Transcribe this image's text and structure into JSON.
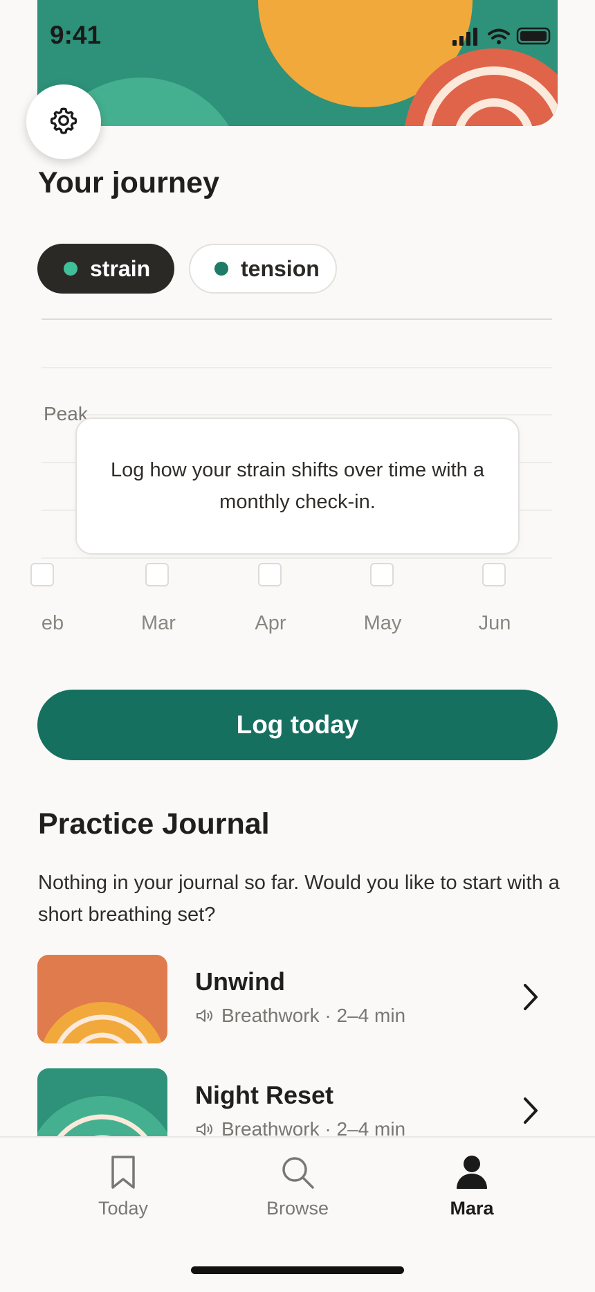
{
  "status_bar": {
    "time": "9:41"
  },
  "header": {
    "settings_icon": "gear-icon"
  },
  "journey": {
    "title": "Your journey",
    "chips": [
      {
        "label": "strain",
        "active": true,
        "dot_color": "#3fbf9a"
      },
      {
        "label": "tension",
        "active": false,
        "dot_color": "#1f7a66"
      }
    ],
    "chart": {
      "peak_label": "Peak",
      "months": [
        "eb",
        "Mar",
        "Apr",
        "May",
        "Jun"
      ],
      "tooltip": "Log how your strain shifts over time with a monthly check-in."
    }
  },
  "log_button": {
    "label": "Log today"
  },
  "journal": {
    "title": "Practice Journal",
    "empty_text": "Nothing in your journal so far. Would you like to start with a short breathing set?",
    "sessions": [
      {
        "name": "Unwind",
        "meta": "Breathwork · 2–4 min",
        "thumb_color": "#e07b4e"
      },
      {
        "name": "Night Reset",
        "meta": "Breathwork · 2–4 min",
        "thumb_color": "#2e9179"
      }
    ]
  },
  "bottom_nav": {
    "items": [
      {
        "label": "Today",
        "icon": "bookmark-icon",
        "active": false
      },
      {
        "label": "Browse",
        "icon": "search-icon",
        "active": false
      },
      {
        "label": "Mara",
        "icon": "person-icon",
        "active": true
      }
    ]
  },
  "colors": {
    "accent": "#16705f",
    "header_green": "#2e9179",
    "header_yellow": "#f2a93b",
    "header_orange": "#e0644a",
    "background": "#faf9f7"
  }
}
